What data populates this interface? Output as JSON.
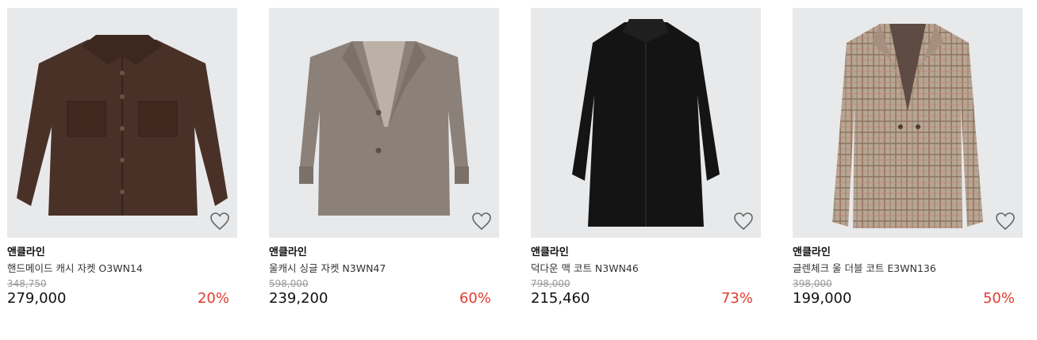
{
  "products": [
    {
      "brand": "앤클라인",
      "name": "핸드메이드 캐시 자켓 O3WN14",
      "original_price": "348,750",
      "price": "279,000",
      "discount": "20%",
      "image": "brown-wool-jacket"
    },
    {
      "brand": "앤클라인",
      "name": "울캐시 싱글 자켓 N3WN47",
      "original_price": "598,000",
      "price": "239,200",
      "discount": "60%",
      "image": "taupe-single-jacket"
    },
    {
      "brand": "앤클라인",
      "name": "덕다운 맥 코트 N3WN46",
      "original_price": "798,000",
      "price": "215,460",
      "discount": "73%",
      "image": "black-down-mac-coat"
    },
    {
      "brand": "앤클라인",
      "name": "글렌체크 울 더블 코트 E3WN136",
      "original_price": "398,000",
      "price": "199,000",
      "discount": "50%",
      "image": "glen-check-double-coat"
    }
  ],
  "colors": {
    "discount": "#e03b2f",
    "thumb_bg": "#e8e9eb",
    "strike": "#9a9a9a"
  }
}
